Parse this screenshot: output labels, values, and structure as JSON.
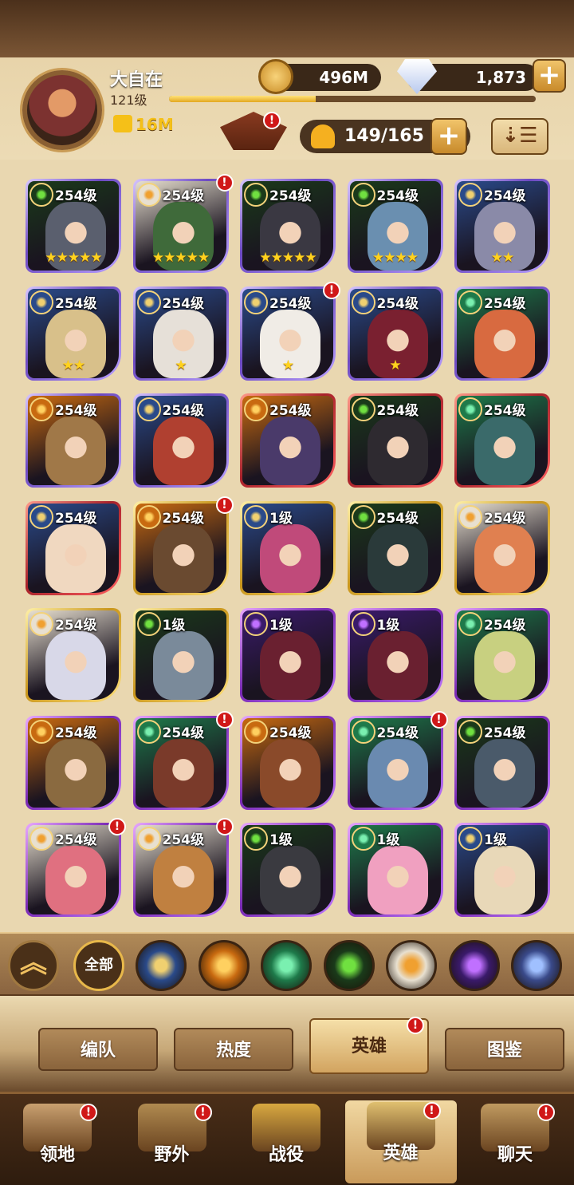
{
  "player": {
    "name": "大自在",
    "level": "121级",
    "power": "16M",
    "xp_progress": 0.4
  },
  "resources": {
    "gold": "496M",
    "gems": "1,873"
  },
  "hero_count": "149/165",
  "colors": {
    "accent_gold": "#f5c018",
    "badge_red": "#d01818",
    "frame_purple": "#6d4ac2",
    "frame_red": "#a8222a",
    "frame_gold": "#c9961c"
  },
  "heroes": [
    {
      "level": "254级",
      "stars": "★★★★★",
      "frame": "purple",
      "faction": "graveborn",
      "badge": false,
      "face": "#5a5f6e"
    },
    {
      "level": "254级",
      "stars": "★★★★★",
      "frame": "purple",
      "faction": "celestial",
      "badge": true,
      "face": "#3f6a3a"
    },
    {
      "level": "254级",
      "stars": "★★★★★",
      "frame": "purple",
      "faction": "graveborn",
      "badge": false,
      "face": "#3a3842"
    },
    {
      "level": "254级",
      "stars": "★★★★",
      "frame": "purple",
      "faction": "graveborn",
      "badge": false,
      "face": "#6a8fb0"
    },
    {
      "level": "254级",
      "stars": "★★",
      "frame": "purple",
      "faction": "lightbearer",
      "badge": false,
      "face": "#8a8aa8"
    },
    {
      "level": "254级",
      "stars": "★★",
      "frame": "purple",
      "faction": "lightbearer",
      "badge": false,
      "face": "#d8c08a"
    },
    {
      "level": "254级",
      "stars": "★",
      "frame": "purple",
      "faction": "lightbearer",
      "badge": false,
      "face": "#e6e0d8"
    },
    {
      "level": "254级",
      "stars": "★",
      "frame": "purple",
      "faction": "lightbearer",
      "badge": true,
      "face": "#f0ece6"
    },
    {
      "level": "254级",
      "stars": "★",
      "frame": "purple",
      "faction": "lightbearer",
      "badge": false,
      "face": "#7a2030"
    },
    {
      "level": "254级",
      "stars": "",
      "frame": "purple",
      "faction": "wilder",
      "badge": false,
      "face": "#d86a40"
    },
    {
      "level": "254级",
      "stars": "",
      "frame": "purple",
      "faction": "mauler",
      "badge": false,
      "face": "#a07848"
    },
    {
      "level": "254级",
      "stars": "",
      "frame": "purple",
      "faction": "lightbearer",
      "badge": false,
      "face": "#b04030"
    },
    {
      "level": "254级",
      "stars": "",
      "frame": "red",
      "faction": "mauler",
      "badge": false,
      "face": "#4a3a6a"
    },
    {
      "level": "254级",
      "stars": "",
      "frame": "red",
      "faction": "graveborn",
      "badge": false,
      "face": "#2e2a30"
    },
    {
      "level": "254级",
      "stars": "",
      "frame": "red",
      "faction": "wilder",
      "badge": false,
      "face": "#3a6a6a"
    },
    {
      "level": "254级",
      "stars": "",
      "frame": "red",
      "faction": "lightbearer",
      "badge": false,
      "face": "#f0d8c0"
    },
    {
      "level": "254级",
      "stars": "",
      "frame": "gold",
      "faction": "mauler",
      "badge": true,
      "face": "#6a4a30"
    },
    {
      "level": "1级",
      "stars": "",
      "frame": "gold",
      "faction": "lightbearer",
      "badge": false,
      "face": "#c04a7a"
    },
    {
      "level": "254级",
      "stars": "",
      "frame": "gold",
      "faction": "graveborn",
      "badge": false,
      "face": "#2a3a3a"
    },
    {
      "level": "254级",
      "stars": "",
      "frame": "gold",
      "faction": "celestial",
      "badge": false,
      "face": "#e08050"
    },
    {
      "level": "254级",
      "stars": "",
      "frame": "gold",
      "faction": "celestial",
      "badge": false,
      "face": "#d8d8e8"
    },
    {
      "level": "1级",
      "stars": "",
      "frame": "gold",
      "faction": "graveborn",
      "badge": false,
      "face": "#7a8a9a"
    },
    {
      "level": "1级",
      "stars": "",
      "frame": "violet",
      "faction": "hypogean",
      "badge": false,
      "face": "#6a2030"
    },
    {
      "level": "1级",
      "stars": "",
      "frame": "violet",
      "faction": "hypogean",
      "badge": false,
      "face": "#6a2030"
    },
    {
      "level": "254级",
      "stars": "",
      "frame": "violet",
      "faction": "wilder",
      "badge": false,
      "face": "#c8d080"
    },
    {
      "level": "254级",
      "stars": "",
      "frame": "violet",
      "faction": "mauler",
      "badge": false,
      "face": "#8a6a40"
    },
    {
      "level": "254级",
      "stars": "",
      "frame": "violet",
      "faction": "wilder",
      "badge": true,
      "face": "#7a3a2a"
    },
    {
      "level": "254级",
      "stars": "",
      "frame": "violet",
      "faction": "mauler",
      "badge": false,
      "face": "#8a4a2a"
    },
    {
      "level": "254级",
      "stars": "",
      "frame": "violet",
      "faction": "wilder",
      "badge": true,
      "face": "#6a8ab0"
    },
    {
      "level": "254级",
      "stars": "",
      "frame": "violet",
      "faction": "graveborn",
      "badge": false,
      "face": "#4a5a6a"
    },
    {
      "level": "254级",
      "stars": "",
      "frame": "violet",
      "faction": "celestial",
      "badge": true,
      "face": "#e07080"
    },
    {
      "level": "254级",
      "stars": "",
      "frame": "violet",
      "faction": "celestial",
      "badge": true,
      "face": "#c08040"
    },
    {
      "level": "1级",
      "stars": "",
      "frame": "violet",
      "faction": "graveborn",
      "badge": false,
      "face": "#3a3a40"
    },
    {
      "level": "1级",
      "stars": "",
      "frame": "violet",
      "faction": "wilder",
      "badge": false,
      "face": "#f0a0c0"
    },
    {
      "level": "1级",
      "stars": "",
      "frame": "violet",
      "faction": "lightbearer",
      "badge": false,
      "face": "#e8d8b8"
    }
  ],
  "filters": {
    "all_label": "全部",
    "factions": [
      {
        "name": "lightbearer",
        "color": "#2a4a8a",
        "accent": "#f0d070"
      },
      {
        "name": "mauler",
        "color": "#c86a10",
        "accent": "#ffd060"
      },
      {
        "name": "wilder",
        "color": "#1e7a4a",
        "accent": "#7af0b0"
      },
      {
        "name": "graveborn",
        "color": "#1a3a1a",
        "accent": "#70e040"
      },
      {
        "name": "celestial",
        "color": "#e8e0d0",
        "accent": "#f0a030"
      },
      {
        "name": "hypogean",
        "color": "#3a1a6a",
        "accent": "#c070ff"
      },
      {
        "name": "dimensional",
        "color": "#3a4a8a",
        "accent": "#a0c0ff"
      }
    ]
  },
  "subtabs": [
    {
      "label": "编队",
      "active": false,
      "badge": false
    },
    {
      "label": "热度",
      "active": false,
      "badge": false
    },
    {
      "label": "英雄",
      "active": true,
      "badge": true
    },
    {
      "label": "图鉴",
      "active": false,
      "badge": false
    }
  ],
  "nav": [
    {
      "label": "领地",
      "active": false,
      "badge": true,
      "icon": "castle-icon"
    },
    {
      "label": "野外",
      "active": false,
      "badge": true,
      "icon": "map-scroll-icon"
    },
    {
      "label": "战役",
      "active": false,
      "badge": false,
      "icon": "sword-shield-icon"
    },
    {
      "label": "英雄",
      "active": true,
      "badge": true,
      "icon": "helmet-icon"
    },
    {
      "label": "聊天",
      "active": false,
      "badge": true,
      "icon": "chat-bubble-icon"
    }
  ]
}
